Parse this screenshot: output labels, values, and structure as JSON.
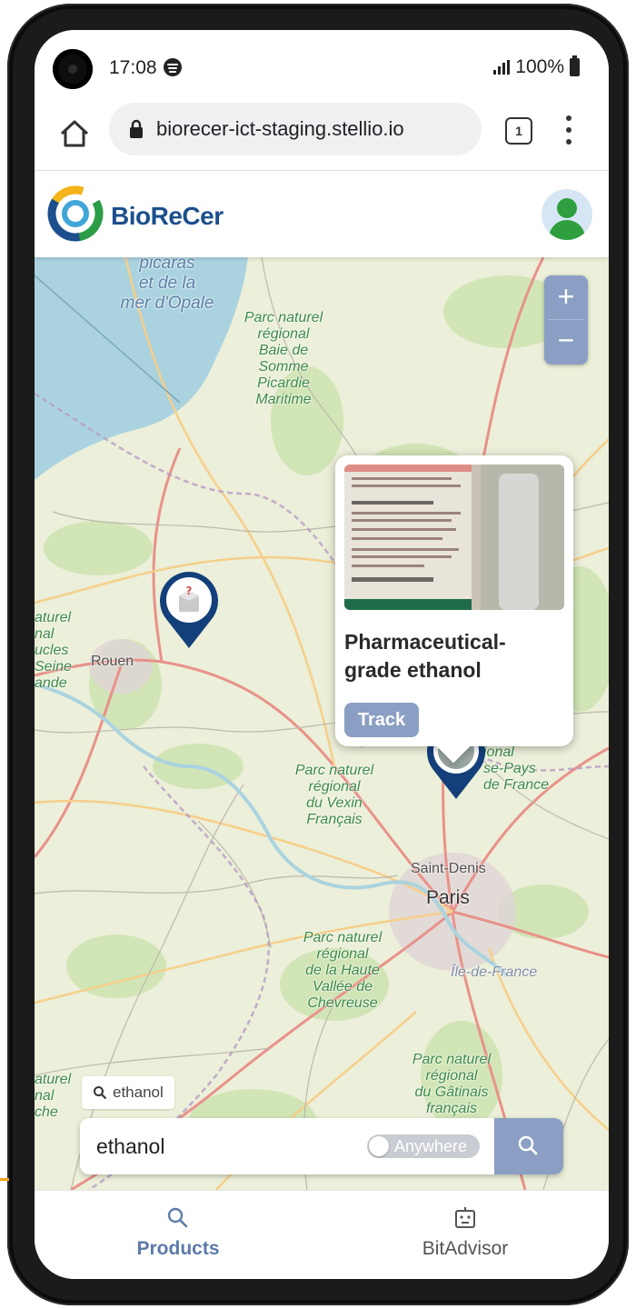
{
  "status_bar": {
    "time": "17:08",
    "battery": "100%"
  },
  "browser": {
    "url": "biorecer-ict-staging.stellio.io",
    "tab_count": "1"
  },
  "header": {
    "brand": "BioReCer"
  },
  "map": {
    "labels": {
      "sea1": "picaras",
      "sea2": "et de la",
      "sea3": "mer d'Opale",
      "park_somme1": "Parc naturel",
      "park_somme2": "régional",
      "park_somme3": "Baie de",
      "park_somme4": "Somme",
      "park_somme5": "Picardie",
      "park_somme6": "Maritime",
      "left1": "aturel",
      "left2": "nal",
      "left3": "ucles",
      "left4": "Seine",
      "left5": "ande",
      "rouen": "Rouen",
      "vexin1": "Parc naturel",
      "vexin2": "régional",
      "vexin3": "du Vexin",
      "vexin4": "Français",
      "oise1": "ional",
      "oise2": "se-Pays",
      "oise3": "de France",
      "saint_denis": "Saint-Denis",
      "paris": "Paris",
      "chevreuse1": "Parc naturel",
      "chevreuse2": "régional",
      "chevreuse3": "de la Haute",
      "chevreuse4": "Vallée de",
      "chevreuse5": "Chevreuse",
      "ile_de_france": "Île-de-France",
      "gatinais1": "Parc naturel",
      "gatinais2": "régional",
      "gatinais3": "du Gâtinais",
      "gatinais4": "français",
      "left6": "aturel",
      "left7": "nal",
      "left8": "che"
    },
    "zoom_in": "+",
    "zoom_out": "−"
  },
  "popup": {
    "title": "Pharmaceutical-grade ethanol",
    "track_label": "Track"
  },
  "search": {
    "chip": "ethanol",
    "value": "ethanol",
    "toggle_label": "Anywhere"
  },
  "bottom_nav": {
    "products": "Products",
    "bitadvisor": "BitAdvisor"
  },
  "colors": {
    "accent": "#8a9fc3",
    "brand": "#1c4f8c",
    "marker": "#133f7a"
  }
}
